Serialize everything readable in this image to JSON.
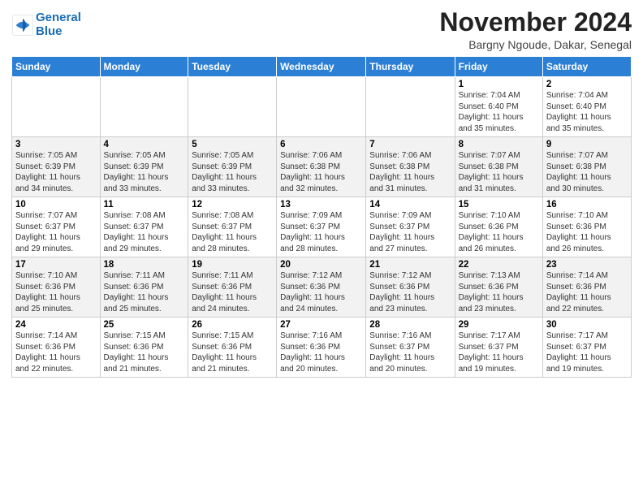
{
  "logo": {
    "line1": "General",
    "line2": "Blue"
  },
  "title": "November 2024",
  "subtitle": "Bargny Ngoude, Dakar, Senegal",
  "weekdays": [
    "Sunday",
    "Monday",
    "Tuesday",
    "Wednesday",
    "Thursday",
    "Friday",
    "Saturday"
  ],
  "weeks": [
    [
      {
        "day": "",
        "info": ""
      },
      {
        "day": "",
        "info": ""
      },
      {
        "day": "",
        "info": ""
      },
      {
        "day": "",
        "info": ""
      },
      {
        "day": "",
        "info": ""
      },
      {
        "day": "1",
        "info": "Sunrise: 7:04 AM\nSunset: 6:40 PM\nDaylight: 11 hours\nand 35 minutes."
      },
      {
        "day": "2",
        "info": "Sunrise: 7:04 AM\nSunset: 6:40 PM\nDaylight: 11 hours\nand 35 minutes."
      }
    ],
    [
      {
        "day": "3",
        "info": "Sunrise: 7:05 AM\nSunset: 6:39 PM\nDaylight: 11 hours\nand 34 minutes."
      },
      {
        "day": "4",
        "info": "Sunrise: 7:05 AM\nSunset: 6:39 PM\nDaylight: 11 hours\nand 33 minutes."
      },
      {
        "day": "5",
        "info": "Sunrise: 7:05 AM\nSunset: 6:39 PM\nDaylight: 11 hours\nand 33 minutes."
      },
      {
        "day": "6",
        "info": "Sunrise: 7:06 AM\nSunset: 6:38 PM\nDaylight: 11 hours\nand 32 minutes."
      },
      {
        "day": "7",
        "info": "Sunrise: 7:06 AM\nSunset: 6:38 PM\nDaylight: 11 hours\nand 31 minutes."
      },
      {
        "day": "8",
        "info": "Sunrise: 7:07 AM\nSunset: 6:38 PM\nDaylight: 11 hours\nand 31 minutes."
      },
      {
        "day": "9",
        "info": "Sunrise: 7:07 AM\nSunset: 6:38 PM\nDaylight: 11 hours\nand 30 minutes."
      }
    ],
    [
      {
        "day": "10",
        "info": "Sunrise: 7:07 AM\nSunset: 6:37 PM\nDaylight: 11 hours\nand 29 minutes."
      },
      {
        "day": "11",
        "info": "Sunrise: 7:08 AM\nSunset: 6:37 PM\nDaylight: 11 hours\nand 29 minutes."
      },
      {
        "day": "12",
        "info": "Sunrise: 7:08 AM\nSunset: 6:37 PM\nDaylight: 11 hours\nand 28 minutes."
      },
      {
        "day": "13",
        "info": "Sunrise: 7:09 AM\nSunset: 6:37 PM\nDaylight: 11 hours\nand 28 minutes."
      },
      {
        "day": "14",
        "info": "Sunrise: 7:09 AM\nSunset: 6:37 PM\nDaylight: 11 hours\nand 27 minutes."
      },
      {
        "day": "15",
        "info": "Sunrise: 7:10 AM\nSunset: 6:36 PM\nDaylight: 11 hours\nand 26 minutes."
      },
      {
        "day": "16",
        "info": "Sunrise: 7:10 AM\nSunset: 6:36 PM\nDaylight: 11 hours\nand 26 minutes."
      }
    ],
    [
      {
        "day": "17",
        "info": "Sunrise: 7:10 AM\nSunset: 6:36 PM\nDaylight: 11 hours\nand 25 minutes."
      },
      {
        "day": "18",
        "info": "Sunrise: 7:11 AM\nSunset: 6:36 PM\nDaylight: 11 hours\nand 25 minutes."
      },
      {
        "day": "19",
        "info": "Sunrise: 7:11 AM\nSunset: 6:36 PM\nDaylight: 11 hours\nand 24 minutes."
      },
      {
        "day": "20",
        "info": "Sunrise: 7:12 AM\nSunset: 6:36 PM\nDaylight: 11 hours\nand 24 minutes."
      },
      {
        "day": "21",
        "info": "Sunrise: 7:12 AM\nSunset: 6:36 PM\nDaylight: 11 hours\nand 23 minutes."
      },
      {
        "day": "22",
        "info": "Sunrise: 7:13 AM\nSunset: 6:36 PM\nDaylight: 11 hours\nand 23 minutes."
      },
      {
        "day": "23",
        "info": "Sunrise: 7:14 AM\nSunset: 6:36 PM\nDaylight: 11 hours\nand 22 minutes."
      }
    ],
    [
      {
        "day": "24",
        "info": "Sunrise: 7:14 AM\nSunset: 6:36 PM\nDaylight: 11 hours\nand 22 minutes."
      },
      {
        "day": "25",
        "info": "Sunrise: 7:15 AM\nSunset: 6:36 PM\nDaylight: 11 hours\nand 21 minutes."
      },
      {
        "day": "26",
        "info": "Sunrise: 7:15 AM\nSunset: 6:36 PM\nDaylight: 11 hours\nand 21 minutes."
      },
      {
        "day": "27",
        "info": "Sunrise: 7:16 AM\nSunset: 6:36 PM\nDaylight: 11 hours\nand 20 minutes."
      },
      {
        "day": "28",
        "info": "Sunrise: 7:16 AM\nSunset: 6:37 PM\nDaylight: 11 hours\nand 20 minutes."
      },
      {
        "day": "29",
        "info": "Sunrise: 7:17 AM\nSunset: 6:37 PM\nDaylight: 11 hours\nand 19 minutes."
      },
      {
        "day": "30",
        "info": "Sunrise: 7:17 AM\nSunset: 6:37 PM\nDaylight: 11 hours\nand 19 minutes."
      }
    ]
  ]
}
